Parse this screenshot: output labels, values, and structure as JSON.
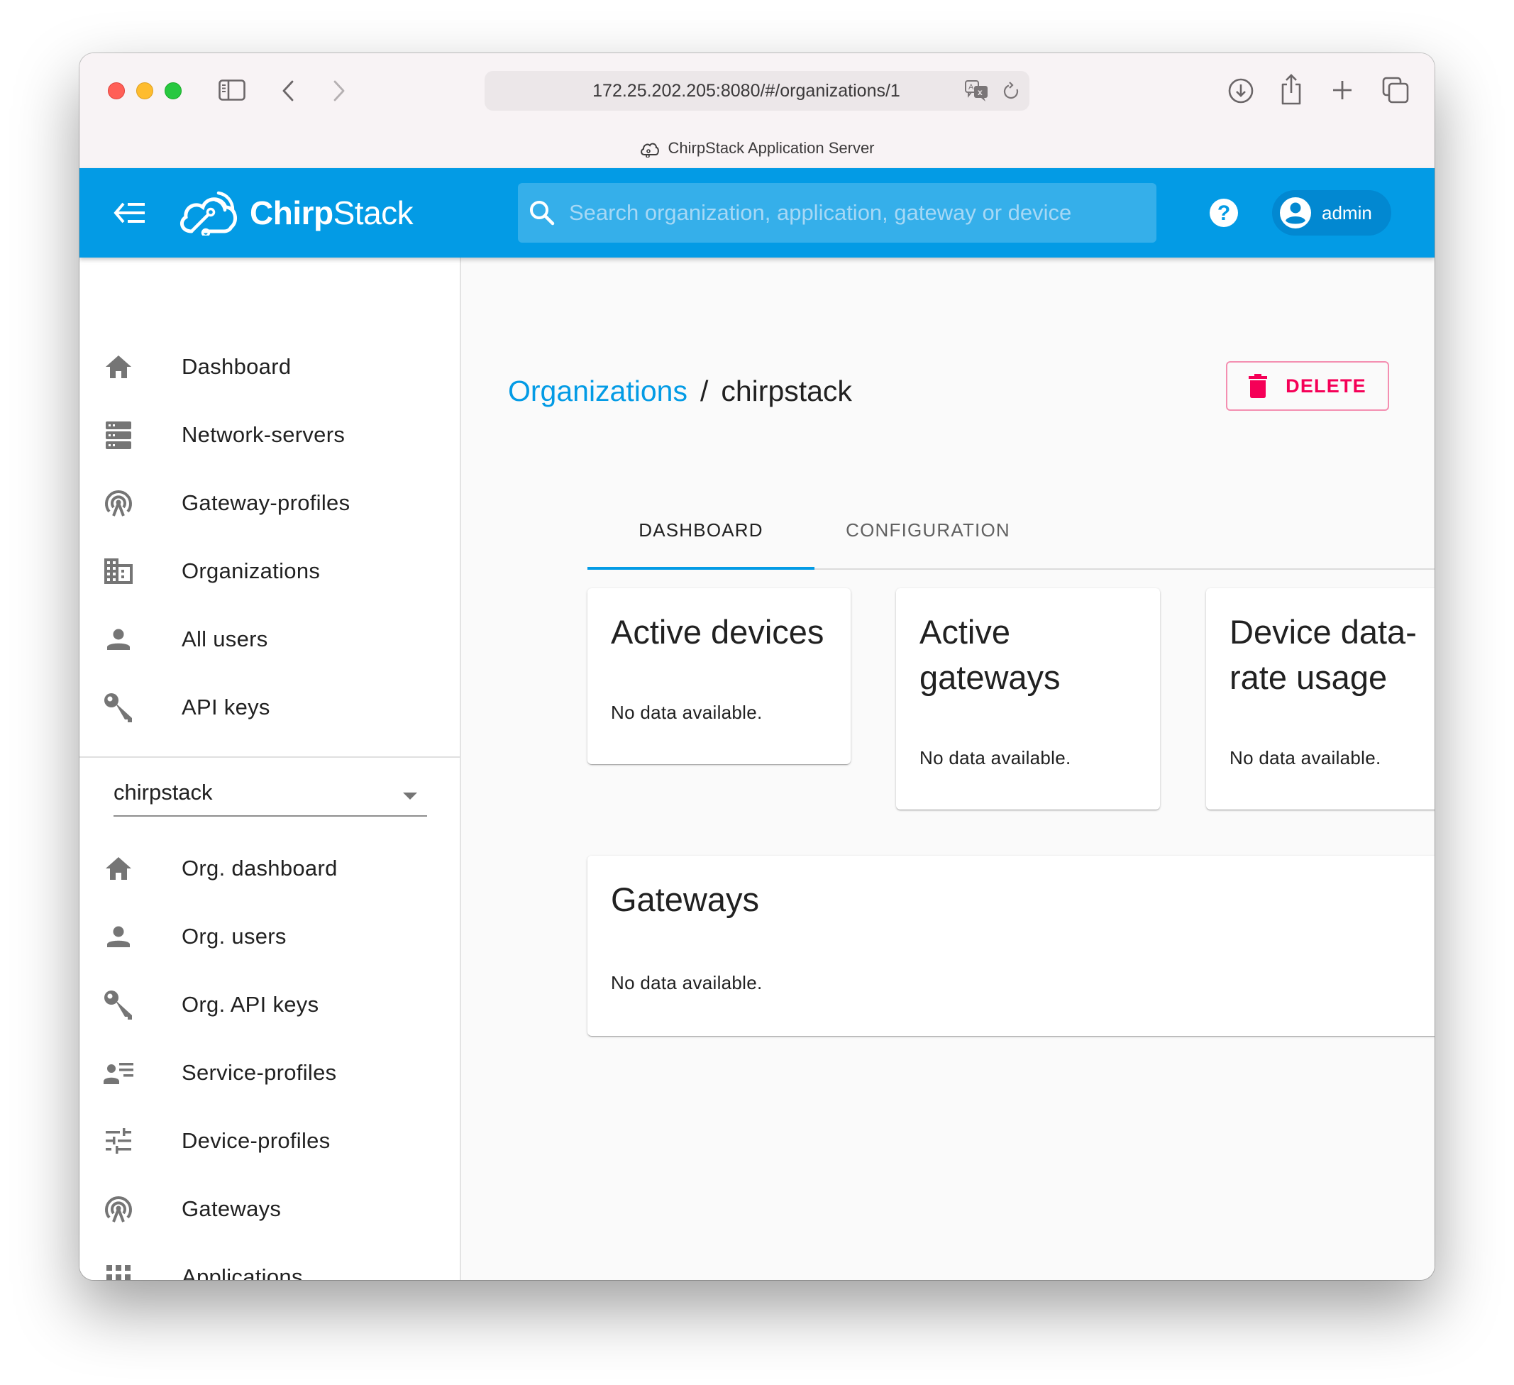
{
  "browser": {
    "url": "172.25.202.205:8080/#/organizations/1",
    "tab_title": "ChirpStack Application Server",
    "icons": [
      "sidebar-toggle-icon",
      "back-icon",
      "forward-icon",
      "translate-icon",
      "reload-icon",
      "download-icon",
      "share-icon",
      "new-tab-icon",
      "tab-overview-icon"
    ]
  },
  "header": {
    "logo_bold": "Chirp",
    "logo_regular": "Stack",
    "search_placeholder": "Search organization, application, gateway or device",
    "search_value": "",
    "user_name": "admin",
    "brand_color": "#039be5"
  },
  "sidebar": {
    "global_items": [
      {
        "label": "Dashboard",
        "icon": "home-icon"
      },
      {
        "label": "Network-servers",
        "icon": "server-icon"
      },
      {
        "label": "Gateway-profiles",
        "icon": "antenna-icon"
      },
      {
        "label": "Organizations",
        "icon": "building-icon"
      },
      {
        "label": "All users",
        "icon": "person-icon"
      },
      {
        "label": "API keys",
        "icon": "key-icon"
      }
    ],
    "org_selector": {
      "value": "chirpstack"
    },
    "org_items": [
      {
        "label": "Org. dashboard",
        "icon": "home-icon"
      },
      {
        "label": "Org. users",
        "icon": "person-icon"
      },
      {
        "label": "Org. API keys",
        "icon": "key-icon"
      },
      {
        "label": "Service-profiles",
        "icon": "account-list-icon"
      },
      {
        "label": "Device-profiles",
        "icon": "tune-icon"
      },
      {
        "label": "Gateways",
        "icon": "antenna-icon"
      },
      {
        "label": "Applications",
        "icon": "apps-grid-icon"
      }
    ]
  },
  "main": {
    "breadcrumb": {
      "parent": "Organizations",
      "separator": "/",
      "current": "chirpstack"
    },
    "delete_label": "DELETE",
    "delete_color": "#f50057",
    "tabs": [
      {
        "label": "DASHBOARD",
        "active": true
      },
      {
        "label": "CONFIGURATION",
        "active": false
      }
    ],
    "cards": [
      {
        "title": "Active devices",
        "body": "No data available."
      },
      {
        "title": "Active gateways",
        "body": "No data available."
      },
      {
        "title": "Device data-rate usage",
        "body": "No data available."
      },
      {
        "title": "Gateways",
        "body": "No data available."
      }
    ]
  }
}
